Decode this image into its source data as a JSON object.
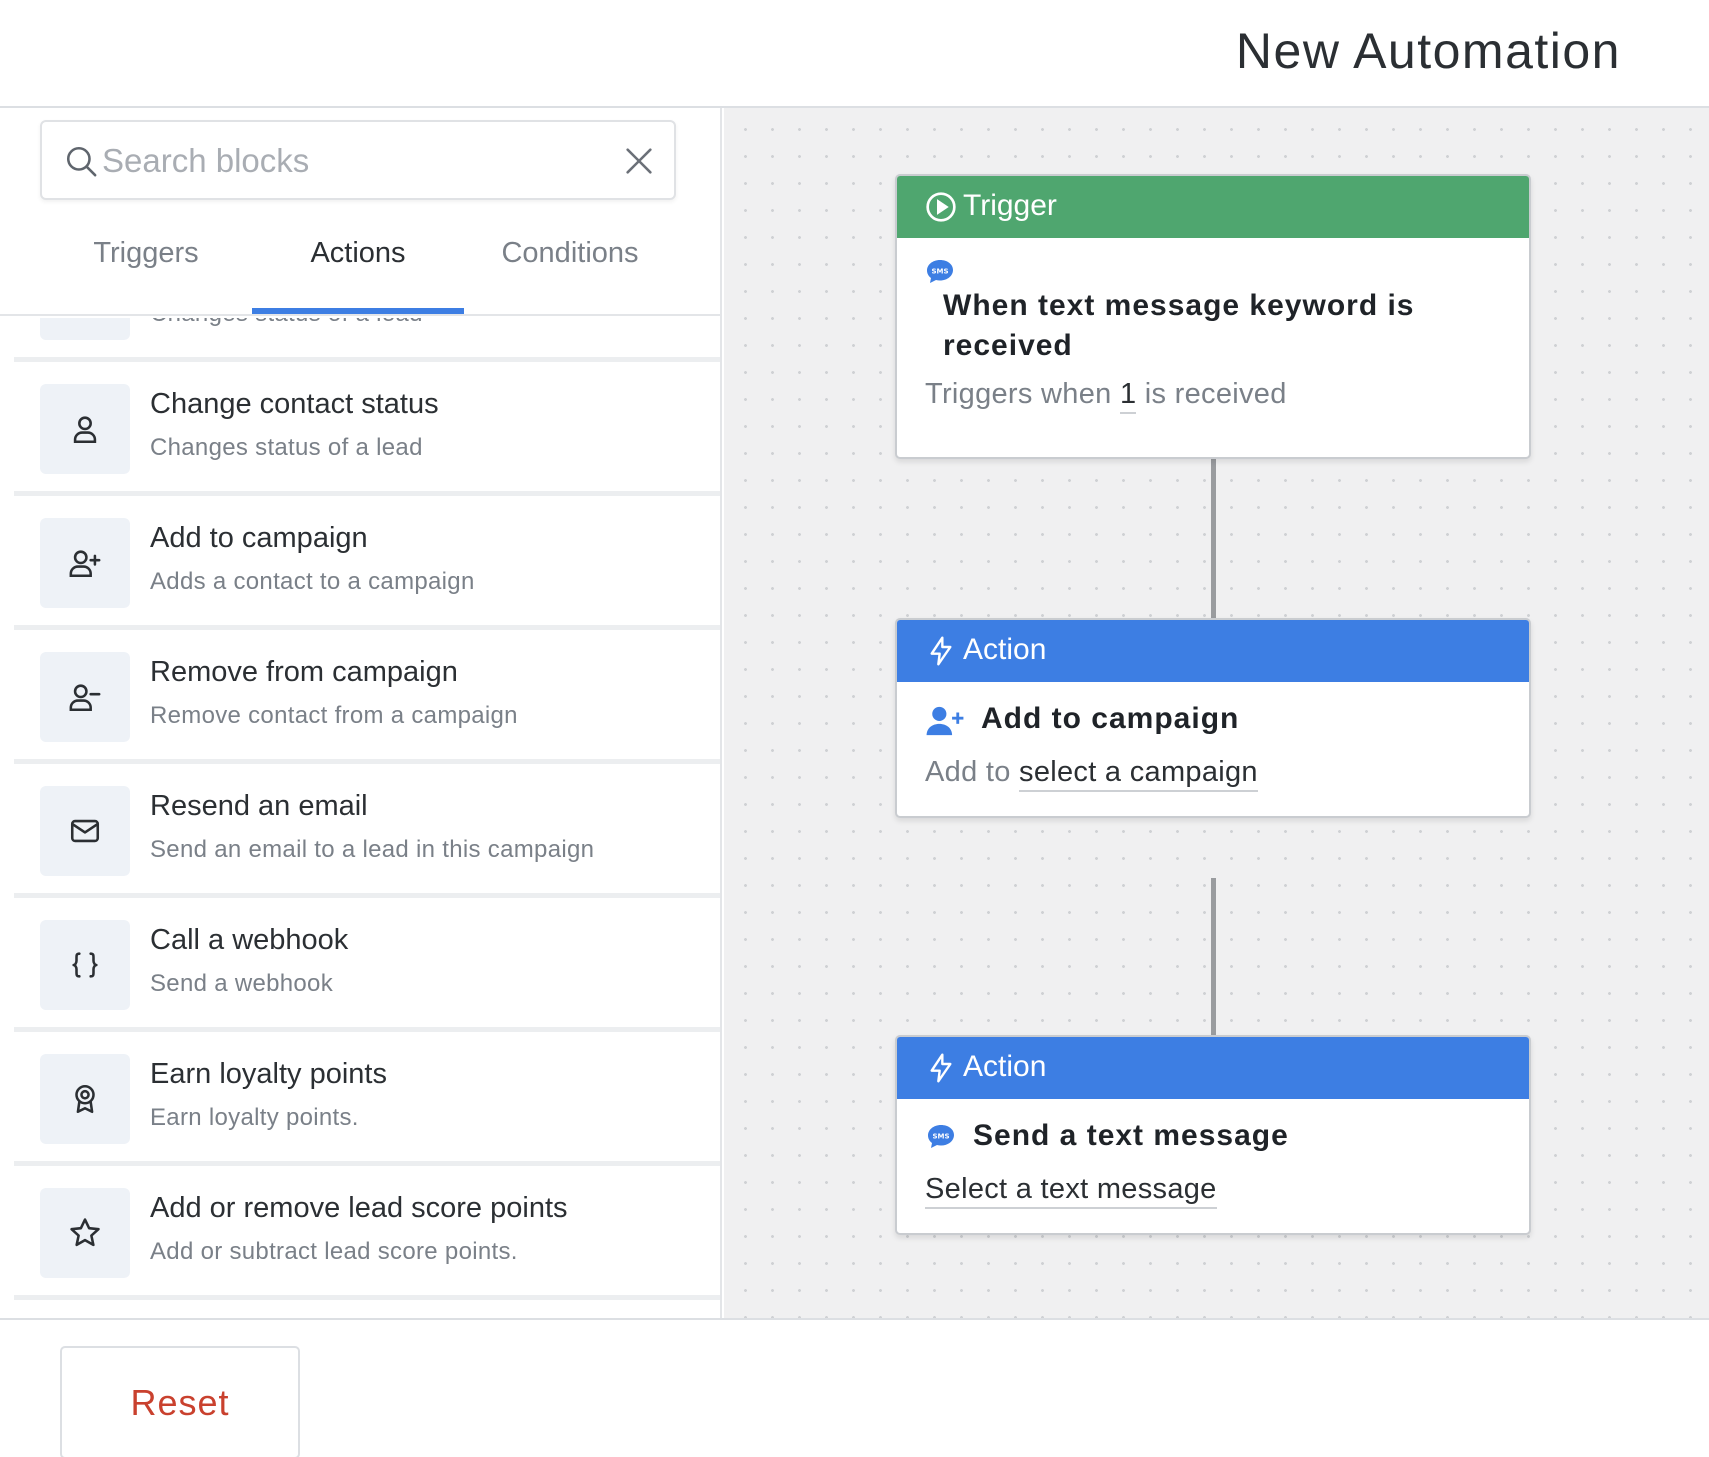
{
  "header": {
    "title": "New Automation"
  },
  "search": {
    "placeholder": "Search blocks",
    "value": ""
  },
  "tabs": [
    {
      "label": "Triggers",
      "active": false
    },
    {
      "label": "Actions",
      "active": true
    },
    {
      "label": "Conditions",
      "active": false
    }
  ],
  "blocks": [
    {
      "icon": "calendar-icon",
      "title": "",
      "description": "Changes status of a lead"
    },
    {
      "icon": "user-icon",
      "title": "Change contact status",
      "description": "Changes status of a lead"
    },
    {
      "icon": "user-plus-icon",
      "title": "Add to campaign",
      "description": "Adds a contact to a campaign"
    },
    {
      "icon": "user-minus-icon",
      "title": "Remove from campaign",
      "description": "Remove contact from a campaign"
    },
    {
      "icon": "envelope-icon",
      "title": "Resend an email",
      "description": "Send an email to a lead in this campaign"
    },
    {
      "icon": "braces-icon",
      "title": "Call a webhook",
      "description": "Send a webhook"
    },
    {
      "icon": "award-icon",
      "title": "Earn loyalty points",
      "description": "Earn loyalty points."
    },
    {
      "icon": "star-icon",
      "title": "Add or remove lead score points",
      "description": "Add or subtract lead score points."
    }
  ],
  "workflow": {
    "trigger": {
      "header": "Trigger",
      "icon": "sms-icon",
      "title_line1": "When text message keyword is",
      "title_line2": "received",
      "sub_prefix": "Triggers when",
      "keyword": "1",
      "sub_suffix": "is received"
    },
    "action1": {
      "header": "Action",
      "icon": "user-plus-icon",
      "title": "Add to campaign",
      "sub_prefix": "Add to",
      "link": "select a campaign"
    },
    "action2": {
      "header": "Action",
      "icon": "sms-icon",
      "title": "Send a text message",
      "link": "Select a text message"
    }
  },
  "footer": {
    "reset_label": "Reset"
  },
  "colors": {
    "trigger": "#4fa66f",
    "action": "#3d7ee3",
    "accent": "#3d7ee3",
    "reset": "#c9412e"
  }
}
